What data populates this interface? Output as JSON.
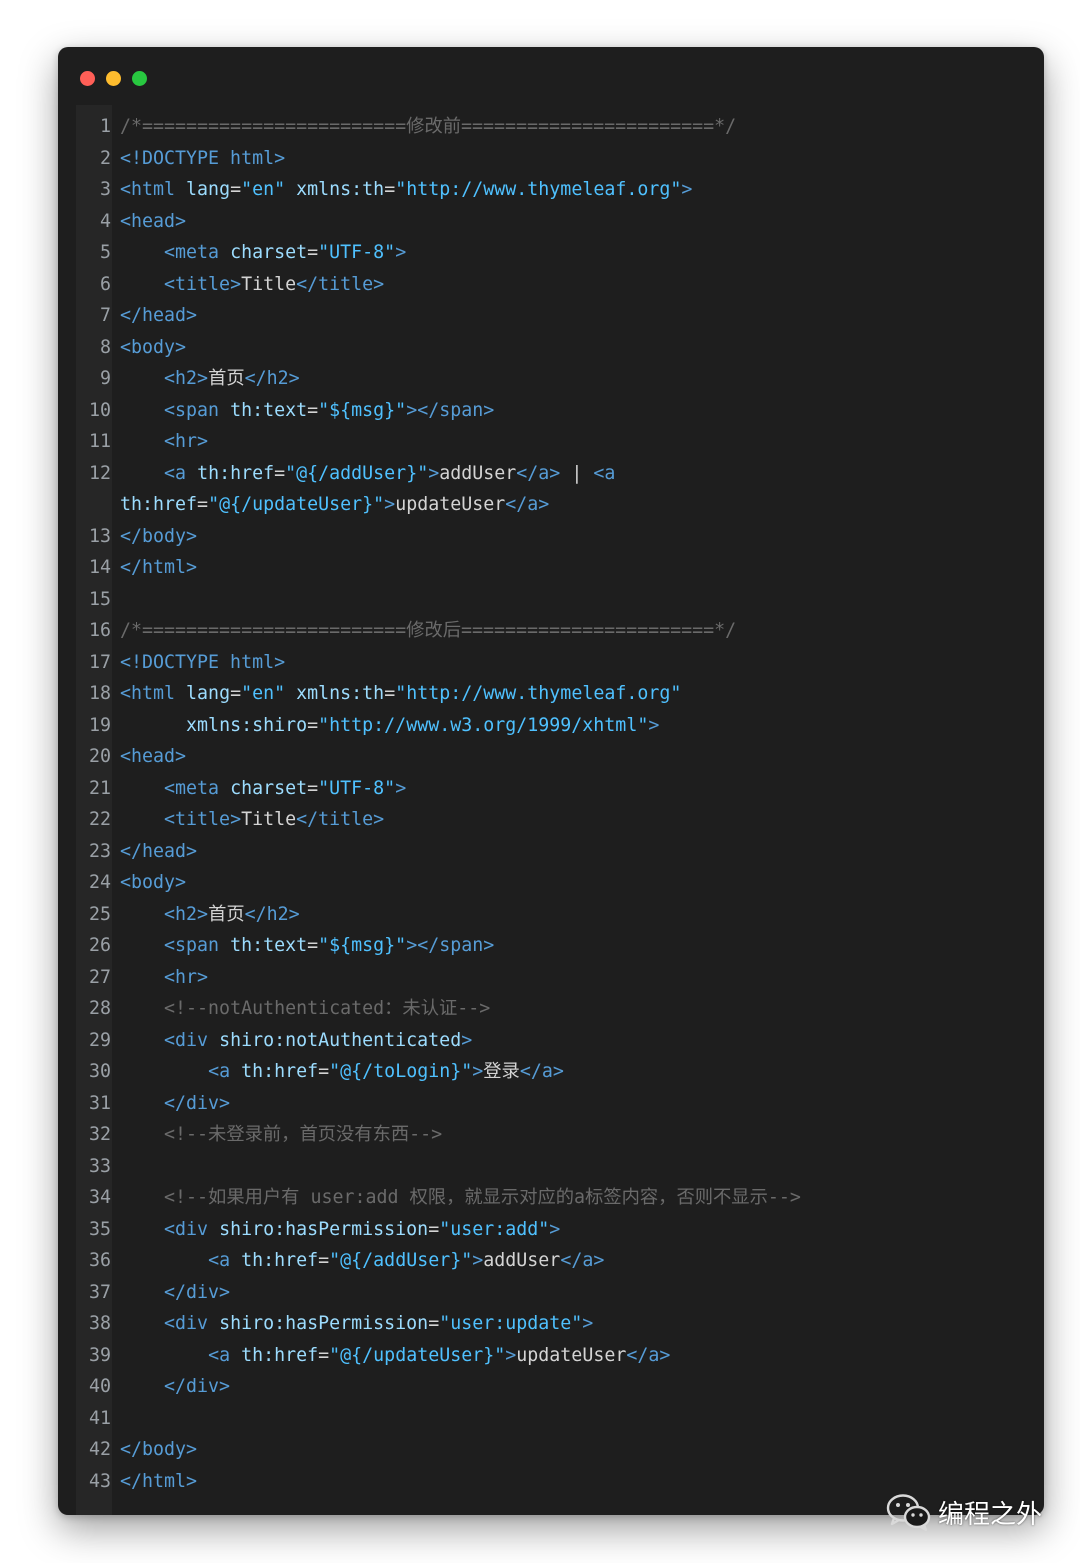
{
  "window": {
    "controls": [
      {
        "name": "close",
        "color": "#ff5f57"
      },
      {
        "name": "minimize",
        "color": "#febc2e"
      },
      {
        "name": "maximize",
        "color": "#28c840"
      }
    ]
  },
  "code_lines": [
    {
      "n": "1",
      "tokens": [
        {
          "t": "cmt",
          "v": "/*========================修改前=======================*/"
        }
      ]
    },
    {
      "n": "2",
      "tokens": [
        {
          "t": "tag",
          "v": "<!DOCTYPE html>"
        }
      ]
    },
    {
      "n": "3",
      "tokens": [
        {
          "t": "tag",
          "v": "<html "
        },
        {
          "t": "attr",
          "v": "lang"
        },
        {
          "t": "plain",
          "v": "="
        },
        {
          "t": "str",
          "v": "\"en\""
        },
        {
          "t": "plain",
          "v": " "
        },
        {
          "t": "attr",
          "v": "xmlns:th"
        },
        {
          "t": "plain",
          "v": "="
        },
        {
          "t": "str",
          "v": "\"http://www.thymeleaf.org\""
        },
        {
          "t": "tag",
          "v": ">"
        }
      ]
    },
    {
      "n": "4",
      "tokens": [
        {
          "t": "tag",
          "v": "<head>"
        }
      ]
    },
    {
      "n": "5",
      "tokens": [
        {
          "t": "plain",
          "v": "    "
        },
        {
          "t": "tag",
          "v": "<meta "
        },
        {
          "t": "attr",
          "v": "charset"
        },
        {
          "t": "plain",
          "v": "="
        },
        {
          "t": "str",
          "v": "\"UTF-8\""
        },
        {
          "t": "tag",
          "v": ">"
        }
      ]
    },
    {
      "n": "6",
      "tokens": [
        {
          "t": "plain",
          "v": "    "
        },
        {
          "t": "tag",
          "v": "<title>"
        },
        {
          "t": "plain",
          "v": "Title"
        },
        {
          "t": "tag",
          "v": "</title>"
        }
      ]
    },
    {
      "n": "7",
      "tokens": [
        {
          "t": "tag",
          "v": "</head>"
        }
      ]
    },
    {
      "n": "8",
      "tokens": [
        {
          "t": "tag",
          "v": "<body>"
        }
      ]
    },
    {
      "n": "9",
      "tokens": [
        {
          "t": "plain",
          "v": "    "
        },
        {
          "t": "tag",
          "v": "<h2>"
        },
        {
          "t": "plain",
          "v": "首页"
        },
        {
          "t": "tag",
          "v": "</h2>"
        }
      ]
    },
    {
      "n": "10",
      "tokens": [
        {
          "t": "plain",
          "v": "    "
        },
        {
          "t": "tag",
          "v": "<span "
        },
        {
          "t": "attr",
          "v": "th:text"
        },
        {
          "t": "plain",
          "v": "="
        },
        {
          "t": "str",
          "v": "\"${msg}\""
        },
        {
          "t": "tag",
          "v": "></span>"
        }
      ]
    },
    {
      "n": "11",
      "tokens": [
        {
          "t": "plain",
          "v": "    "
        },
        {
          "t": "tag",
          "v": "<hr>"
        }
      ]
    },
    {
      "n": "12",
      "tokens": [
        {
          "t": "plain",
          "v": "    "
        },
        {
          "t": "tag",
          "v": "<a "
        },
        {
          "t": "attr",
          "v": "th:href"
        },
        {
          "t": "plain",
          "v": "="
        },
        {
          "t": "str",
          "v": "\"@{/addUser}\""
        },
        {
          "t": "tag",
          "v": ">"
        },
        {
          "t": "plain",
          "v": "addUser"
        },
        {
          "t": "tag",
          "v": "</a>"
        },
        {
          "t": "plain",
          "v": " | "
        },
        {
          "t": "tag",
          "v": "<a"
        }
      ]
    },
    {
      "n": "",
      "tokens": [
        {
          "t": "attr",
          "v": "th:href"
        },
        {
          "t": "plain",
          "v": "="
        },
        {
          "t": "str",
          "v": "\"@{/updateUser}\""
        },
        {
          "t": "tag",
          "v": ">"
        },
        {
          "t": "plain",
          "v": "updateUser"
        },
        {
          "t": "tag",
          "v": "</a>"
        }
      ]
    },
    {
      "n": "13",
      "tokens": [
        {
          "t": "tag",
          "v": "</body>"
        }
      ]
    },
    {
      "n": "14",
      "tokens": [
        {
          "t": "tag",
          "v": "</html>"
        }
      ]
    },
    {
      "n": "15",
      "tokens": []
    },
    {
      "n": "16",
      "tokens": [
        {
          "t": "cmt",
          "v": "/*========================修改后=======================*/"
        }
      ]
    },
    {
      "n": "17",
      "tokens": [
        {
          "t": "tag",
          "v": "<!DOCTYPE html>"
        }
      ]
    },
    {
      "n": "18",
      "tokens": [
        {
          "t": "tag",
          "v": "<html "
        },
        {
          "t": "attr",
          "v": "lang"
        },
        {
          "t": "plain",
          "v": "="
        },
        {
          "t": "str",
          "v": "\"en\""
        },
        {
          "t": "plain",
          "v": " "
        },
        {
          "t": "attr",
          "v": "xmlns:th"
        },
        {
          "t": "plain",
          "v": "="
        },
        {
          "t": "str",
          "v": "\"http://www.thymeleaf.org\""
        }
      ]
    },
    {
      "n": "19",
      "tokens": [
        {
          "t": "plain",
          "v": "      "
        },
        {
          "t": "attr",
          "v": "xmlns:shiro"
        },
        {
          "t": "plain",
          "v": "="
        },
        {
          "t": "str",
          "v": "\"http://www.w3.org/1999/xhtml\""
        },
        {
          "t": "tag",
          "v": ">"
        }
      ]
    },
    {
      "n": "20",
      "tokens": [
        {
          "t": "tag",
          "v": "<head>"
        }
      ]
    },
    {
      "n": "21",
      "tokens": [
        {
          "t": "plain",
          "v": "    "
        },
        {
          "t": "tag",
          "v": "<meta "
        },
        {
          "t": "attr",
          "v": "charset"
        },
        {
          "t": "plain",
          "v": "="
        },
        {
          "t": "str",
          "v": "\"UTF-8\""
        },
        {
          "t": "tag",
          "v": ">"
        }
      ]
    },
    {
      "n": "22",
      "tokens": [
        {
          "t": "plain",
          "v": "    "
        },
        {
          "t": "tag",
          "v": "<title>"
        },
        {
          "t": "plain",
          "v": "Title"
        },
        {
          "t": "tag",
          "v": "</title>"
        }
      ]
    },
    {
      "n": "23",
      "tokens": [
        {
          "t": "tag",
          "v": "</head>"
        }
      ]
    },
    {
      "n": "24",
      "tokens": [
        {
          "t": "tag",
          "v": "<body>"
        }
      ]
    },
    {
      "n": "25",
      "tokens": [
        {
          "t": "plain",
          "v": "    "
        },
        {
          "t": "tag",
          "v": "<h2>"
        },
        {
          "t": "plain",
          "v": "首页"
        },
        {
          "t": "tag",
          "v": "</h2>"
        }
      ]
    },
    {
      "n": "26",
      "tokens": [
        {
          "t": "plain",
          "v": "    "
        },
        {
          "t": "tag",
          "v": "<span "
        },
        {
          "t": "attr",
          "v": "th:text"
        },
        {
          "t": "plain",
          "v": "="
        },
        {
          "t": "str",
          "v": "\"${msg}\""
        },
        {
          "t": "tag",
          "v": "></span>"
        }
      ]
    },
    {
      "n": "27",
      "tokens": [
        {
          "t": "plain",
          "v": "    "
        },
        {
          "t": "tag",
          "v": "<hr>"
        }
      ]
    },
    {
      "n": "28",
      "tokens": [
        {
          "t": "plain",
          "v": "    "
        },
        {
          "t": "cmt",
          "v": "<!--notAuthenticated：未认证-->"
        }
      ]
    },
    {
      "n": "29",
      "tokens": [
        {
          "t": "plain",
          "v": "    "
        },
        {
          "t": "tag",
          "v": "<div "
        },
        {
          "t": "attr",
          "v": "shiro:notAuthenticated"
        },
        {
          "t": "tag",
          "v": ">"
        }
      ]
    },
    {
      "n": "30",
      "tokens": [
        {
          "t": "plain",
          "v": "        "
        },
        {
          "t": "tag",
          "v": "<a "
        },
        {
          "t": "attr",
          "v": "th:href"
        },
        {
          "t": "plain",
          "v": "="
        },
        {
          "t": "str",
          "v": "\"@{/toLogin}\""
        },
        {
          "t": "tag",
          "v": ">"
        },
        {
          "t": "plain",
          "v": "登录"
        },
        {
          "t": "tag",
          "v": "</a>"
        }
      ]
    },
    {
      "n": "31",
      "tokens": [
        {
          "t": "plain",
          "v": "    "
        },
        {
          "t": "tag",
          "v": "</div>"
        }
      ]
    },
    {
      "n": "32",
      "tokens": [
        {
          "t": "plain",
          "v": "    "
        },
        {
          "t": "cmt",
          "v": "<!--未登录前，首页没有东西-->"
        }
      ]
    },
    {
      "n": "33",
      "tokens": []
    },
    {
      "n": "34",
      "tokens": [
        {
          "t": "plain",
          "v": "    "
        },
        {
          "t": "cmt",
          "v": "<!--如果用户有 user:add 权限，就显示对应的a标签内容，否则不显示-->"
        }
      ]
    },
    {
      "n": "35",
      "tokens": [
        {
          "t": "plain",
          "v": "    "
        },
        {
          "t": "tag",
          "v": "<div "
        },
        {
          "t": "attr",
          "v": "shiro:hasPermission"
        },
        {
          "t": "plain",
          "v": "="
        },
        {
          "t": "str",
          "v": "\"user:add\""
        },
        {
          "t": "tag",
          "v": ">"
        }
      ]
    },
    {
      "n": "36",
      "tokens": [
        {
          "t": "plain",
          "v": "        "
        },
        {
          "t": "tag",
          "v": "<a "
        },
        {
          "t": "attr",
          "v": "th:href"
        },
        {
          "t": "plain",
          "v": "="
        },
        {
          "t": "str",
          "v": "\"@{/addUser}\""
        },
        {
          "t": "tag",
          "v": ">"
        },
        {
          "t": "plain",
          "v": "addUser"
        },
        {
          "t": "tag",
          "v": "</a>"
        }
      ]
    },
    {
      "n": "37",
      "tokens": [
        {
          "t": "plain",
          "v": "    "
        },
        {
          "t": "tag",
          "v": "</div>"
        }
      ]
    },
    {
      "n": "38",
      "tokens": [
        {
          "t": "plain",
          "v": "    "
        },
        {
          "t": "tag",
          "v": "<div "
        },
        {
          "t": "attr",
          "v": "shiro:hasPermission"
        },
        {
          "t": "plain",
          "v": "="
        },
        {
          "t": "str",
          "v": "\"user:update\""
        },
        {
          "t": "tag",
          "v": ">"
        }
      ]
    },
    {
      "n": "39",
      "tokens": [
        {
          "t": "plain",
          "v": "        "
        },
        {
          "t": "tag",
          "v": "<a "
        },
        {
          "t": "attr",
          "v": "th:href"
        },
        {
          "t": "plain",
          "v": "="
        },
        {
          "t": "str",
          "v": "\"@{/updateUser}\""
        },
        {
          "t": "tag",
          "v": ">"
        },
        {
          "t": "plain",
          "v": "updateUser"
        },
        {
          "t": "tag",
          "v": "</a>"
        }
      ]
    },
    {
      "n": "40",
      "tokens": [
        {
          "t": "plain",
          "v": "    "
        },
        {
          "t": "tag",
          "v": "</div>"
        }
      ]
    },
    {
      "n": "41",
      "tokens": []
    },
    {
      "n": "42",
      "tokens": [
        {
          "t": "tag",
          "v": "</body>"
        }
      ]
    },
    {
      "n": "43",
      "tokens": [
        {
          "t": "tag",
          "v": "</html>"
        }
      ]
    }
  ],
  "watermark": {
    "text": "编程之外",
    "icon": "wechat-icon"
  }
}
